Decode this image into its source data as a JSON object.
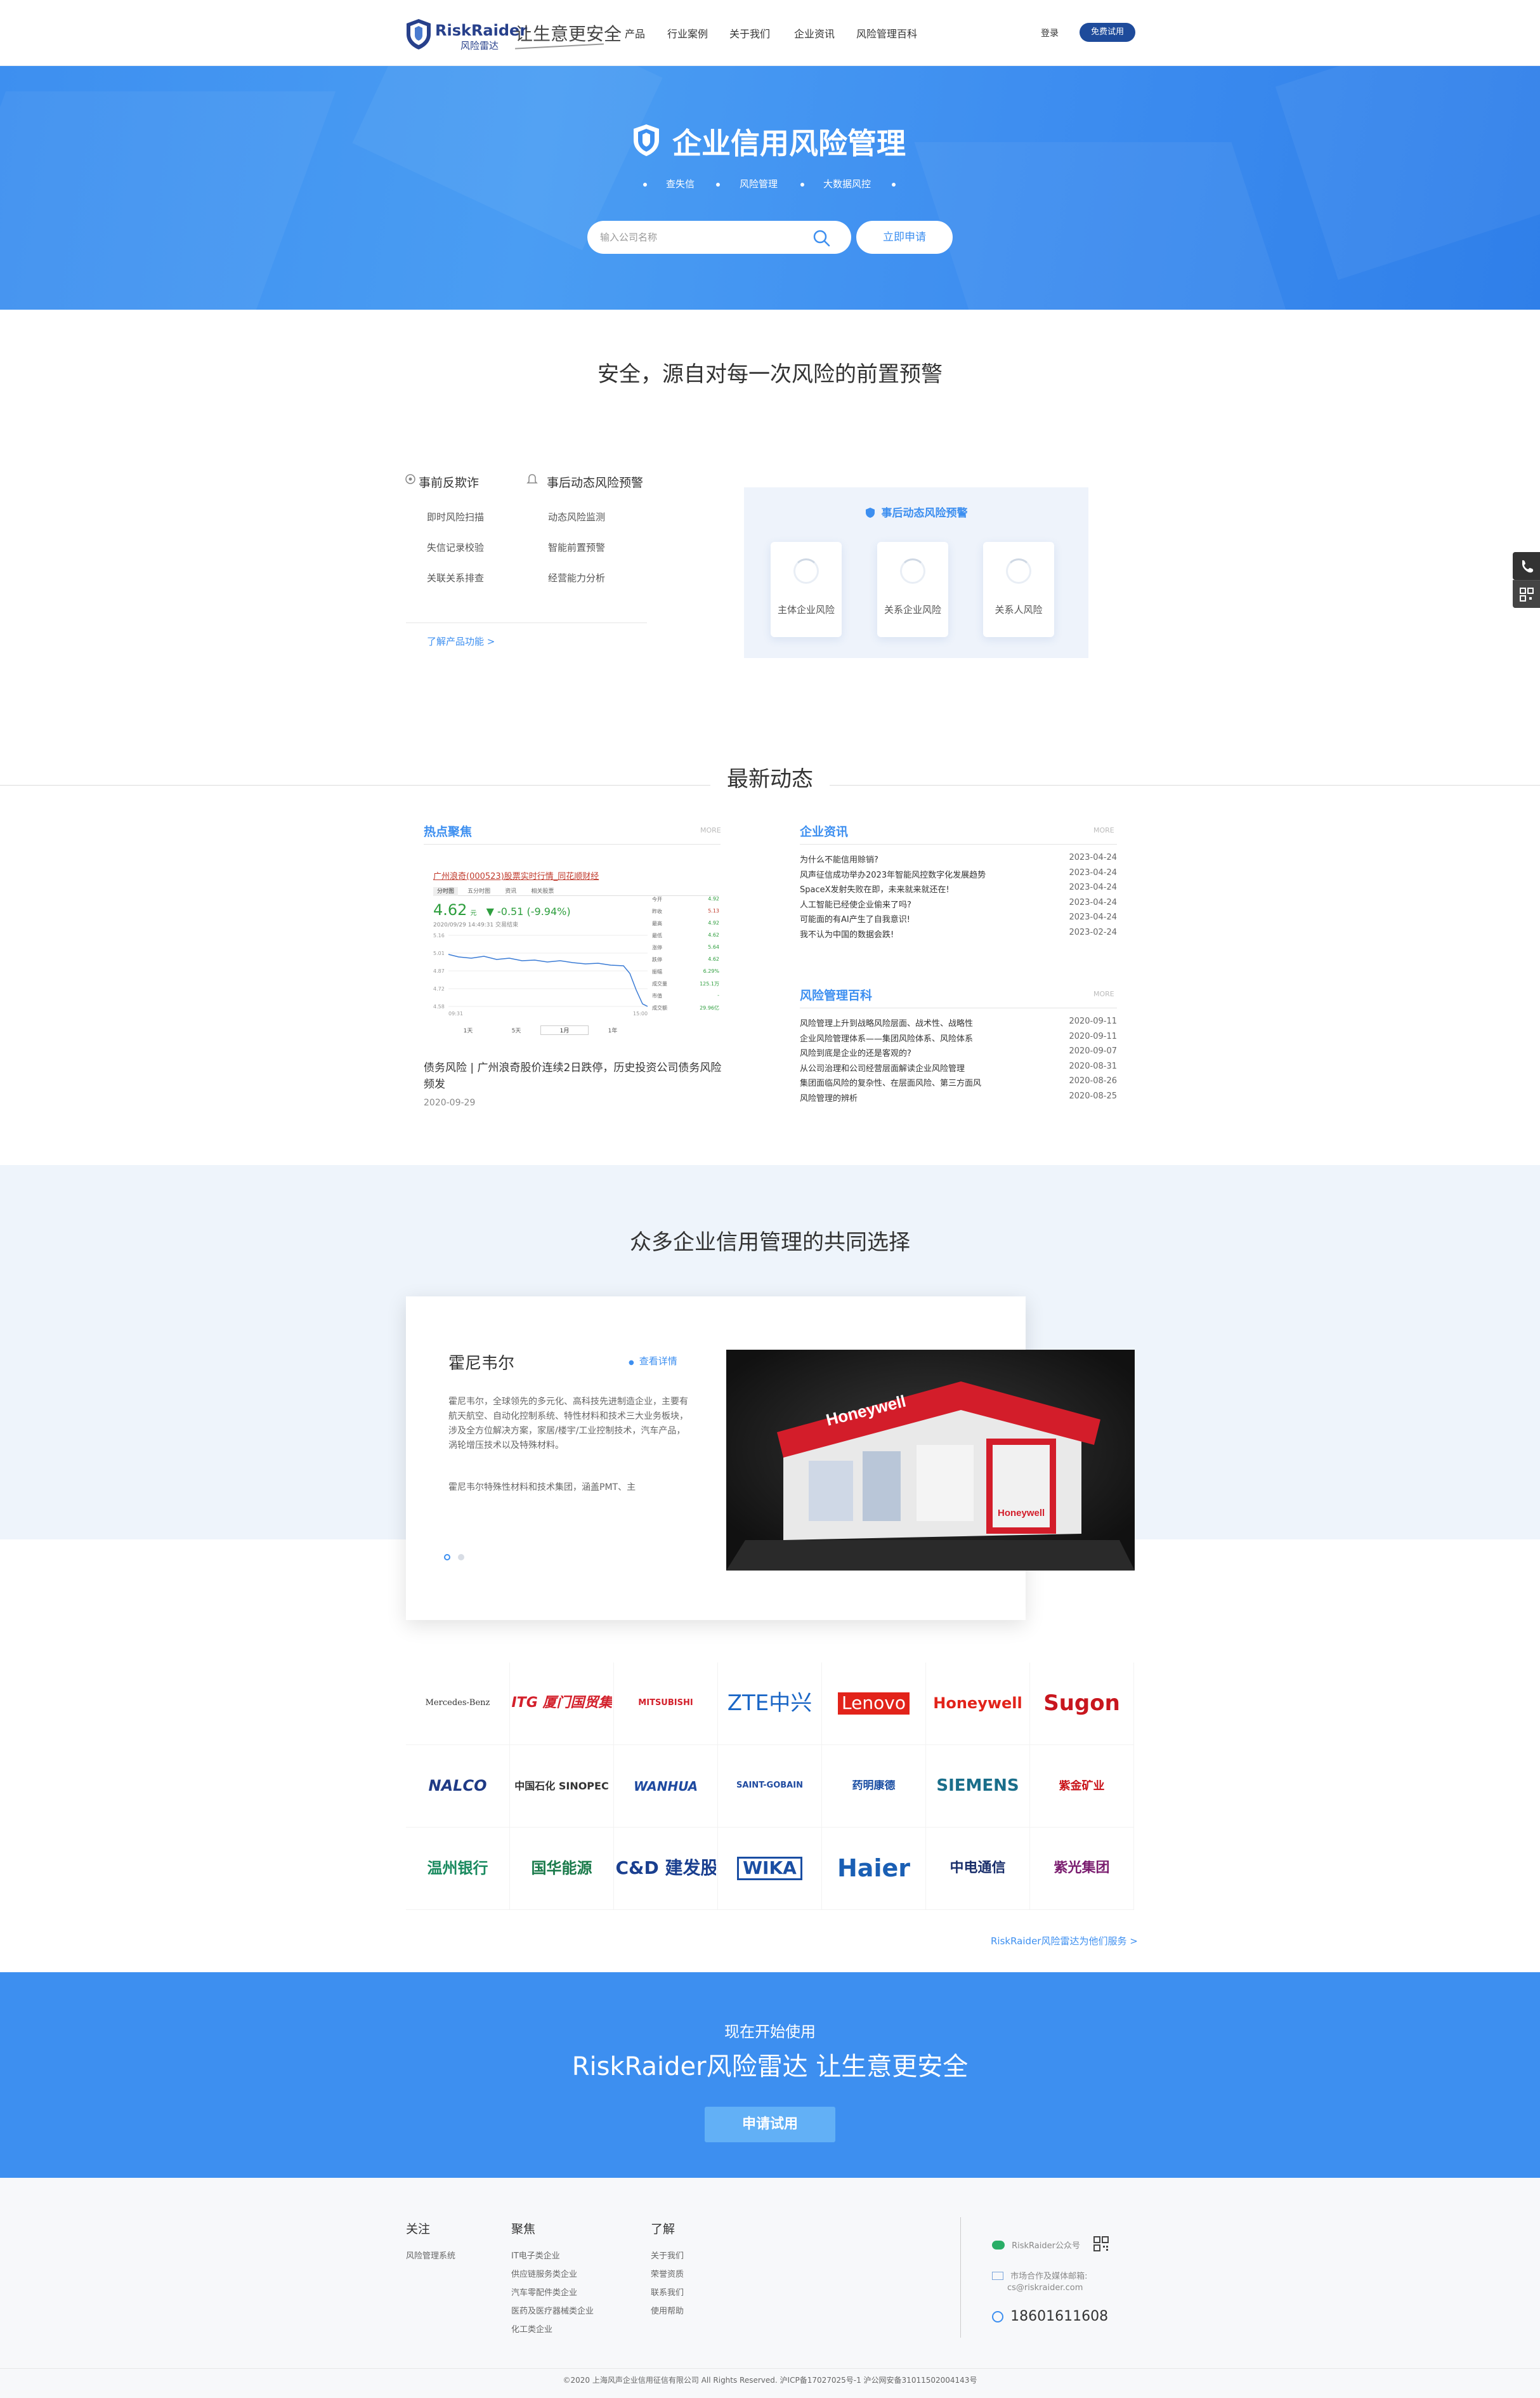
{
  "header": {
    "logo_en": "RiskRaider",
    "logo_cn": "风险雷达",
    "slogan": "让生意更安全",
    "nav": [
      "产品",
      "行业案例",
      "关于我们",
      "企业资讯",
      "风险管理百科"
    ],
    "login": "登录",
    "trial": "免费试用"
  },
  "hero": {
    "title": "企业信用风险管理",
    "tags": [
      "查失信",
      "风险管理",
      "大数据风控"
    ],
    "search_placeholder": "输入公司名称",
    "apply": "立即申请"
  },
  "features": {
    "title": "安全，源自对每一次风险的前置预警",
    "col1_title": "事前反欺诈",
    "col1_items": [
      "即时风险扫描",
      "失信记录校验",
      "关联关系排查"
    ],
    "col2_title": "事后动态风险预警",
    "col2_items": [
      "动态风险监测",
      "智能前置预警",
      "经营能力分析"
    ],
    "more": "了解产品功能 >",
    "panel_title": "事后动态风险预警",
    "cards": [
      "主体企业风险",
      "关系企业风险",
      "关系人风险"
    ]
  },
  "news": {
    "title": "最新动态",
    "hot": {
      "head": "热点聚焦",
      "more": "MORE",
      "stock_title": "广州浪奇(000523)股票实时行情_同花顺财经",
      "stock_tabs": [
        "分时图",
        "五分时图",
        "资讯",
        "相关股票"
      ],
      "stock_price": "4.62",
      "stock_unit": "元",
      "stock_change": "-0.51 (-9.94%)",
      "stock_time": "2020/09/29 14:49:31",
      "stock_status": "交易结束",
      "stock_range": [
        "1天",
        "5天",
        "1月",
        "1年"
      ],
      "stock_ylabels": [
        "5.16",
        "5.01",
        "4.87",
        "4.72",
        "4.58"
      ],
      "stock_xlabels": [
        "09:31",
        "15:00"
      ],
      "stock_stats": [
        [
          "今开",
          "4.92"
        ],
        [
          "昨收",
          "5.13"
        ],
        [
          "最高",
          "4.92"
        ],
        [
          "最低",
          "4.62"
        ],
        [
          "涨停",
          "5.64"
        ],
        [
          "跌停",
          "4.62"
        ],
        [
          "振幅",
          "6.29%"
        ],
        [
          "成交量",
          "125.1万"
        ],
        [
          "市值",
          "-"
        ],
        [
          "成交额",
          "29.96亿"
        ]
      ],
      "caption": "债务风险 | 广州浪奇股价连续2日跌停，历史投资公司债务风险频发",
      "date": "2020-09-29"
    },
    "company": {
      "head": "企业资讯",
      "more": "MORE",
      "items": [
        {
          "t": "为什么不能信用赊销?",
          "d": "2023-04-24"
        },
        {
          "t": "风声征信成功举办2023年智能风控数字化发展趋势",
          "d": "2023-04-24"
        },
        {
          "t": "SpaceX发射失败在即，未来就来就还在!",
          "d": "2023-04-24"
        },
        {
          "t": "人工智能已经使企业偷来了吗?",
          "d": "2023-04-24"
        },
        {
          "t": "可能面的有AI产生了自我意识!",
          "d": "2023-04-24"
        },
        {
          "t": "我不认为中国的数据会跌!",
          "d": "2023-02-24"
        }
      ]
    },
    "wiki": {
      "head": "风险管理百科",
      "more": "MORE",
      "items": [
        {
          "t": "风险管理上升到战略风险层面、战术性、战略性",
          "d": "2020-09-11"
        },
        {
          "t": "企业风险管理体系——集团风险体系、风险体系",
          "d": "2020-09-11"
        },
        {
          "t": "风险到底是企业的还是客观的?",
          "d": "2020-09-07"
        },
        {
          "t": "从公司治理和公司经营层面解读企业风险管理",
          "d": "2020-08-31"
        },
        {
          "t": "集团面临风险的复杂性、在层面风险、第三方面风",
          "d": "2020-08-26"
        },
        {
          "t": "风险管理的辨析",
          "d": "2020-08-25"
        }
      ]
    }
  },
  "clients": {
    "title": "众多企业信用管理的共同选择",
    "case_name": "霍尼韦尔",
    "case_more": "查看详情",
    "case_desc": "霍尼韦尔，全球领先的多元化、高科技先进制造企业，主要有航天航空、自动化控制系统、特性材料和技术三大业务板块，涉及全方位解决方案，家居/楼宇/工业控制技术，汽车产品，涡轮增压技术以及特殊材料。",
    "case_desc2": "霍尼韦尔特殊性材料和技术集团，涵盖PMT、主",
    "case_brand": "Honeywell",
    "logos": [
      "Mercedes-Benz",
      "ITG 厦门国贸集团",
      "MITSUBISHI",
      "ZTE中兴",
      "Lenovo",
      "Honeywell",
      "Sugon",
      "NALCO",
      "中国石化 SINOPEC",
      "WANHUA",
      "SAINT-GOBAIN",
      "药明康德",
      "SIEMENS",
      "紫金矿业",
      "温州银行",
      "国华能源",
      "C&D 建发股份",
      "WIKA",
      "Haier",
      "中电通信",
      "紫光集团"
    ],
    "more": "RiskRaider风险雷达为他们服务 >"
  },
  "cta": {
    "sub": "现在开始使用",
    "title": "RiskRaider风险雷达 让生意更安全",
    "button": "申请试用"
  },
  "footer": {
    "col1": {
      "head": "关注",
      "links": [
        "风险管理系统"
      ]
    },
    "col2": {
      "head": "聚焦",
      "links": [
        "IT电子类企业",
        "供应链服务类企业",
        "汽车零配件类企业",
        "医药及医疗器械类企业",
        "化工类企业"
      ]
    },
    "col3": {
      "head": "了解",
      "links": [
        "关于我们",
        "荣誉资质",
        "联系我们",
        "使用帮助"
      ]
    },
    "wechat": "RiskRaider公众号",
    "email_label": "市场合作及媒体邮箱:",
    "email": "cs@riskraider.com",
    "phone": "18601611608",
    "copyright": "©2020 上海风声企业信用征信有限公司 All Rights Reserved. 沪ICP备17027025号-1 沪公网安备31011502004143号"
  },
  "colors": {
    "brand_blue": "#3d8ff0",
    "dark_navy": "#1e4b9b",
    "logo_navy": "#27408b"
  }
}
